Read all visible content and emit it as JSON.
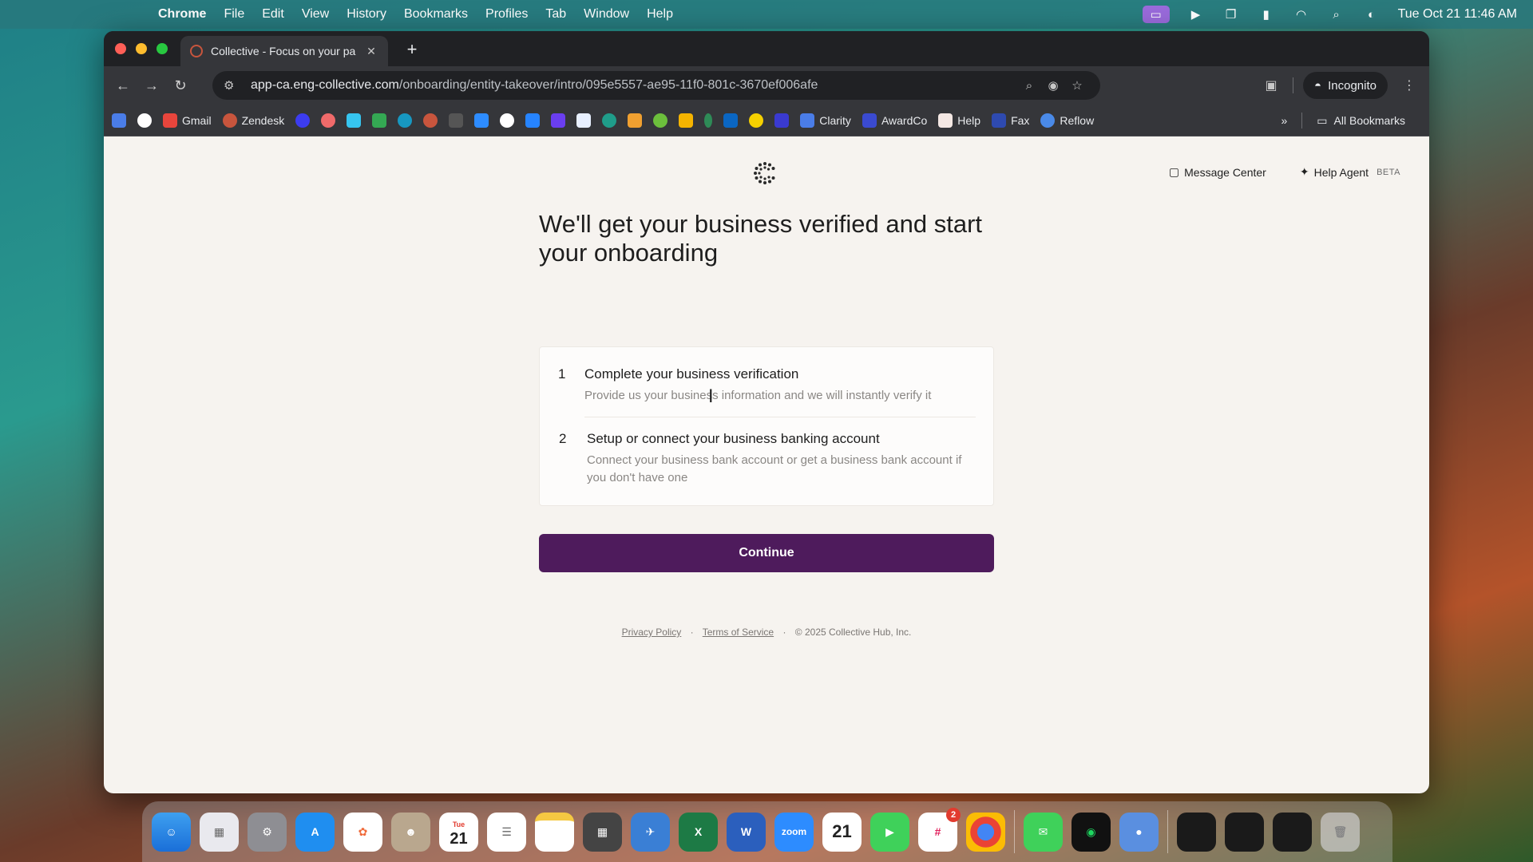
{
  "menubar": {
    "app_name": "Chrome",
    "menus": [
      "File",
      "Edit",
      "View",
      "History",
      "Bookmarks",
      "Profiles",
      "Tab",
      "Window",
      "Help"
    ],
    "clock": "Tue Oct 21  11:46 AM"
  },
  "browser": {
    "tab_title": "Collective - Focus on your pa",
    "url_host": "app-ca.eng-collective.com",
    "url_path": "/onboarding/entity-takeover/intro/095e5557-ae95-11f0-801c-3670ef006afe",
    "incognito_label": "Incognito",
    "bookmarks": [
      "Gmail",
      "Zendesk",
      "Clarity",
      "AwardCo",
      "Help",
      "Fax",
      "Reflow"
    ],
    "all_bookmarks_label": "All Bookmarks"
  },
  "page": {
    "message_center": "Message Center",
    "help_agent": "Help Agent",
    "beta_label": "BETA",
    "headline": "We'll get your business verified and start your onboarding",
    "steps": [
      {
        "number": "1",
        "title": "Complete your business verification",
        "description": "Provide us your business information and we will instantly verify it"
      },
      {
        "number": "2",
        "title": "Setup or connect your business banking account",
        "description": "Connect your business bank account or get a business bank account if you don't have one"
      }
    ],
    "continue_label": "Continue",
    "footer": {
      "privacy": "Privacy Policy",
      "terms": "Terms of Service",
      "copyright": "© 2025 Collective Hub, Inc."
    }
  },
  "dock": {
    "calendar_day": "21",
    "calendar_month": "Tue",
    "slack_badge": "2",
    "zoom_label": "zoom"
  },
  "colors": {
    "continue_button": "#4e1b5c",
    "page_background": "#f6f3ef"
  }
}
